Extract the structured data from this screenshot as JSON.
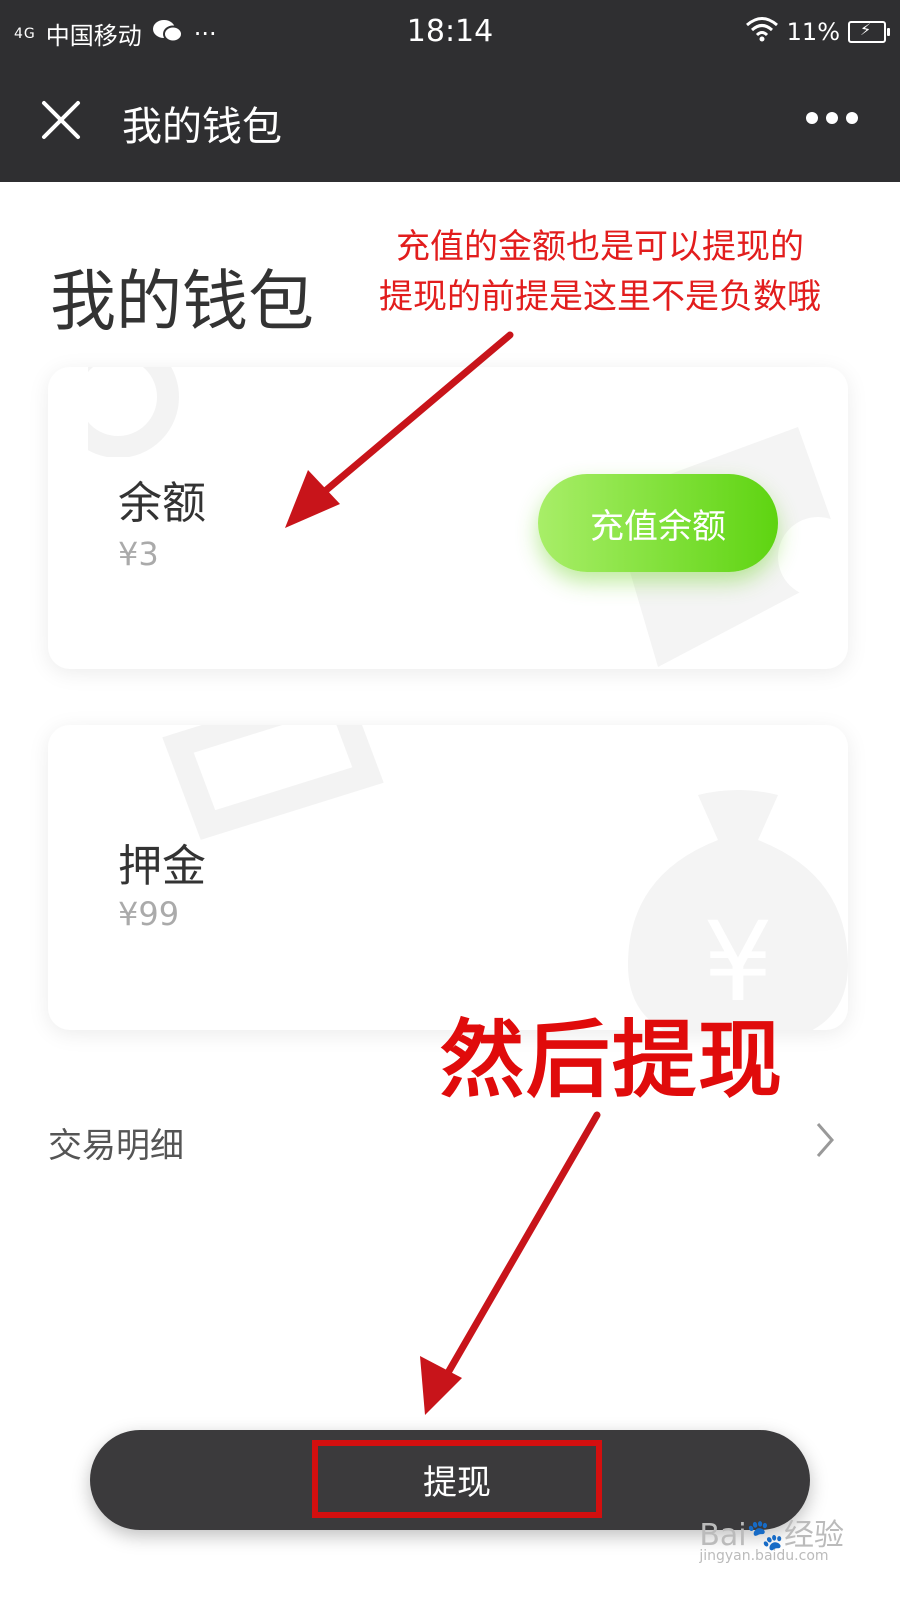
{
  "status_bar": {
    "signal": "4G",
    "carrier": "中国移动",
    "time": "18:14",
    "battery": "11%"
  },
  "titlebar": {
    "title": "我的钱包"
  },
  "page": {
    "heading": "我的钱包"
  },
  "annotations": {
    "top_line1": "充值的金额也是可以提现的",
    "top_line2": "提现的前提是这里不是负数哦",
    "big": "然后提现"
  },
  "balance_card": {
    "label": "余额",
    "value": "¥3",
    "button_label": "充值余额"
  },
  "deposit_card": {
    "label": "押金",
    "value": "¥99"
  },
  "transactions": {
    "label": "交易明细"
  },
  "withdraw": {
    "label": "提现"
  },
  "watermark": {
    "text": "Bai",
    "text2": "经验",
    "url": "jingyan.baidu.com"
  },
  "colors": {
    "header_bg": "#2f2f31",
    "accent_green": "#6fd620",
    "annotation_red": "#e00b0b"
  }
}
